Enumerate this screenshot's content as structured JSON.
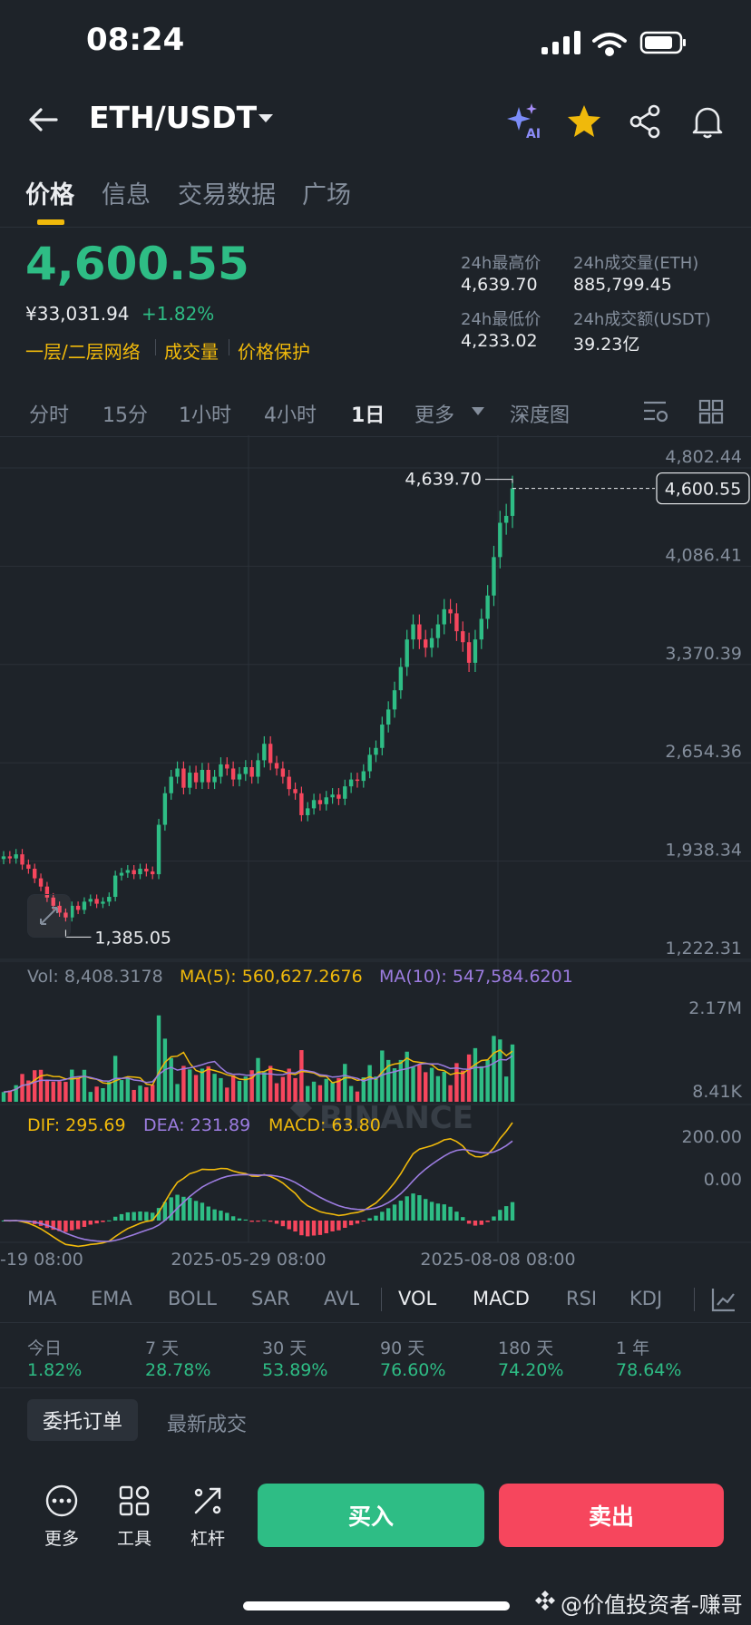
{
  "status_bar": {
    "time": "08:24"
  },
  "header": {
    "pair": "ETH/USDT"
  },
  "tabs": [
    {
      "label": "价格"
    },
    {
      "label": "信息"
    },
    {
      "label": "交易数据"
    },
    {
      "label": "广场"
    }
  ],
  "price": {
    "last": "4,600.55",
    "cny": "¥33,031.94",
    "change": "+1.82%",
    "links": [
      "一层/二层网络",
      "成交量",
      "价格保护"
    ]
  },
  "stats": {
    "high_label": "24h最高价",
    "high": "4,639.70",
    "low_label": "24h最低价",
    "low": "4,233.02",
    "vol_label": "24h成交量(ETH)",
    "vol": "885,799.45",
    "amount_label": "24h成交额(USDT)",
    "amount": "39.23亿"
  },
  "intervals": [
    "分时",
    "15分",
    "1小时",
    "4小时",
    "1日",
    "更多",
    "深度图"
  ],
  "chart_data": {
    "type": "candlestick",
    "y_ticks": [
      "4,802.44",
      "4,086.41",
      "3,370.39",
      "2,654.36",
      "1,938.34",
      "1,222.31"
    ],
    "ylim": [
      1222.31,
      4802.44
    ],
    "high_marker": "4,639.70",
    "low_marker": "1,385.05",
    "last_price": "4,600.55",
    "watermark": "BINANCE",
    "closes": [
      1920,
      1905,
      1935,
      1860,
      1830,
      1760,
      1700,
      1620,
      1560,
      1510,
      1475,
      1560,
      1530,
      1590,
      1610,
      1575,
      1590,
      1625,
      1780,
      1800,
      1820,
      1790,
      1830,
      1810,
      1790,
      2150,
      2380,
      2500,
      2560,
      2420,
      2530,
      2460,
      2550,
      2460,
      2500,
      2590,
      2560,
      2480,
      2520,
      2570,
      2500,
      2620,
      2740,
      2600,
      2560,
      2500,
      2410,
      2380,
      2220,
      2270,
      2330,
      2300,
      2350,
      2370,
      2340,
      2430,
      2480,
      2470,
      2540,
      2660,
      2710,
      2880,
      2990,
      3130,
      3300,
      3500,
      3610,
      3500,
      3440,
      3510,
      3610,
      3720,
      3690,
      3560,
      3480,
      3330,
      3500,
      3650,
      3820,
      4100,
      4350,
      4400,
      4600.55
    ],
    "volume": {
      "label": "Vol: 8,408.3178",
      "ma5": "MA(5): 560,627.2676",
      "ma10": "MA(10): 547,584.6201",
      "y_ticks": [
        "2.17M",
        "8.41K"
      ]
    },
    "macd": {
      "dif": "DIF: 295.69",
      "dea": "DEA: 231.89",
      "macd": "MACD: 63.80",
      "y_ticks": [
        "200.00",
        "0.00"
      ]
    },
    "x_ticks": [
      "-19 08:00",
      "2025-05-29 08:00",
      "2025-08-08 08:00"
    ]
  },
  "indicators": [
    "MA",
    "EMA",
    "BOLL",
    "SAR",
    "AVL",
    "VOL",
    "MACD",
    "RSI",
    "KDJ"
  ],
  "performance": [
    {
      "label": "今日",
      "value": "1.82%"
    },
    {
      "label": "7 天",
      "value": "28.78%"
    },
    {
      "label": "30 天",
      "value": "53.89%"
    },
    {
      "label": "90 天",
      "value": "76.60%"
    },
    {
      "label": "180 天",
      "value": "74.20%"
    },
    {
      "label": "1 年",
      "value": "78.64%"
    }
  ],
  "order_tabs": {
    "orders": "委托订单",
    "trades": "最新成交"
  },
  "bottom": {
    "more": "更多",
    "tools": "工具",
    "leverage": "杠杆",
    "buy": "买入",
    "sell": "卖出",
    "watermark": "@价值投资者-赚哥"
  },
  "colors": {
    "up": "#2ebd85",
    "down": "#f6465d",
    "accent": "#f0b90b",
    "ma10": "#9c7ce0"
  }
}
